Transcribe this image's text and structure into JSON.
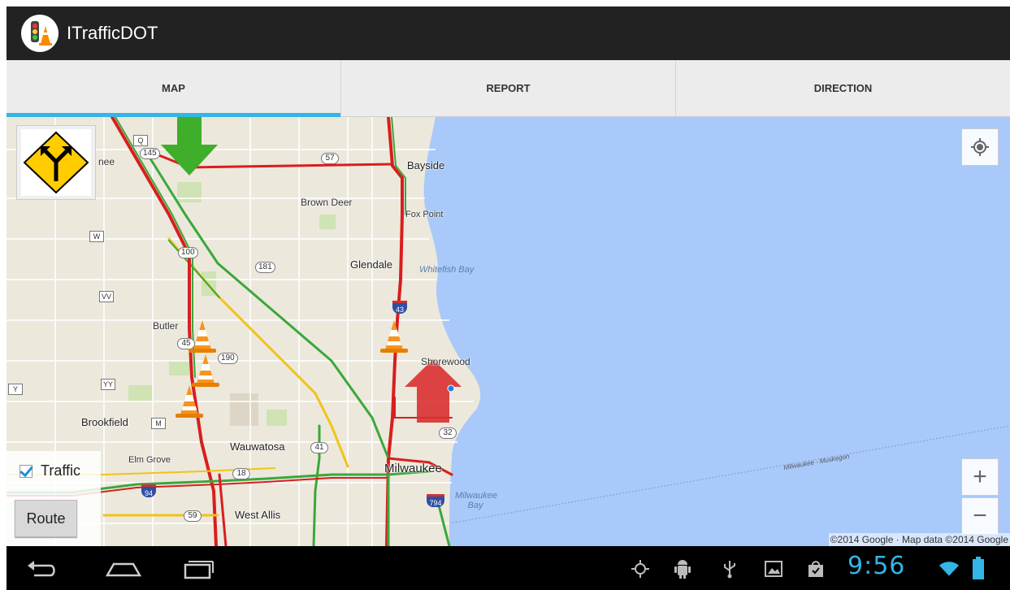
{
  "app": {
    "title": "ITrafficDOT"
  },
  "tabs": [
    {
      "label": "MAP",
      "active": true
    },
    {
      "label": "REPORT",
      "active": false
    },
    {
      "label": "DIRECTION",
      "active": false
    }
  ],
  "map": {
    "places": {
      "bayside": "Bayside",
      "brown_deer": "Brown Deer",
      "fox_point": "Fox Point",
      "glendale": "Glendale",
      "whitefish_bay": "Whitefish Bay",
      "butler": "Butler",
      "shorewood": "Shorewood",
      "brookfield": "Brookfield",
      "wauwatosa": "Wauwatosa",
      "elm_grove": "Elm Grove",
      "milwaukee": "Milwaukee",
      "milwaukee_bay": "Milwaukee Bay",
      "west_allis": "West Allis",
      "ferry": "Milwaukee - Muskegon",
      "nee": "nee"
    },
    "shields": {
      "q": "Q",
      "r145": "145",
      "r57": "57",
      "w": "W",
      "r100": "100",
      "r181": "181",
      "vv": "VV",
      "r45": "45",
      "r190": "190",
      "i43": "43",
      "y": "Y",
      "yy": "YY",
      "m": "M",
      "r41": "41",
      "r32": "32",
      "r18": "18",
      "i94": "94",
      "r59": "59",
      "i794": "794"
    },
    "attribution": "©2014 Google · Map data ©2014 Google",
    "zoom_in_label": "+",
    "zoom_out_label": "−"
  },
  "controls": {
    "traffic_label": "Traffic",
    "traffic_checked": true,
    "route_label": "Route"
  },
  "status_bar": {
    "time": "9:56"
  },
  "colors": {
    "accent": "#33b5e5",
    "water": "#a8c9f9",
    "land": "#ece8dc",
    "traffic_red": "#d81e1e",
    "traffic_green": "#3aa83a",
    "traffic_yellow": "#f0c419"
  }
}
